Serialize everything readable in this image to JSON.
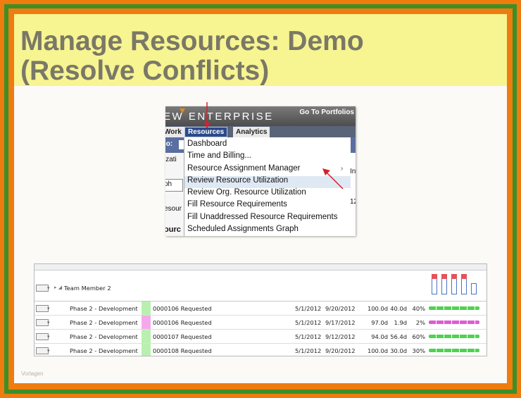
{
  "slide": {
    "title_line1": "Manage Resources: Demo",
    "title_line2": "(Resolve Conflicts)",
    "footer_note": "Vorlagen"
  },
  "colors": {
    "frame_orange": "#ee7c0e",
    "frame_green": "#3e8e28",
    "title_band": "#f7f492",
    "title_text": "#7a7866",
    "nav_active": "#2c4a8a",
    "menu_highlight": "#dfe9f4",
    "arrow_red": "#d7212a",
    "swatch_green": "#b9f0b0",
    "swatch_pink": "#f6a8ec",
    "bar_green": "#4fd24f",
    "bar_pink": "#e25bd4",
    "conflict_red": "#e2535a"
  },
  "menu_screenshot": {
    "brand": "EW ENTERPRISE",
    "header_link": "Go To Portfolios",
    "tabs": {
      "work": "Work",
      "resources": "Resources",
      "analytics": "Analytics"
    },
    "left_panel": {
      "label": "io:",
      "text_1": "izati",
      "text_2": "ph",
      "text_3": "esour",
      "text_4": "ourc"
    },
    "right_panel": {
      "text_1": "In",
      "text_2": "12"
    },
    "dropdown_items": [
      {
        "label": "Dashboard"
      },
      {
        "label": "Time and Billing..."
      },
      {
        "label": "Resource Assignment Manager"
      },
      {
        "label": "Review Resource Utilization"
      },
      {
        "label": "Review Org. Resource Utilization"
      },
      {
        "label": "Fill Resource Requirements"
      },
      {
        "label": "Fill Unaddressed Resource Requirements"
      },
      {
        "label": "Scheduled Assignments Graph"
      }
    ],
    "submenu_arrow": "›"
  },
  "grid_screenshot": {
    "team_label": "Team Member 2",
    "rows": [
      {
        "phase": "Phase 2 - Development",
        "swatch": "green",
        "id": "0000106",
        "status": "Requested",
        "start": "5/1/2012",
        "end": "9/20/2012",
        "total": "100.0d",
        "assigned": "40.0d",
        "percent": "40%",
        "bar": "green"
      },
      {
        "phase": "Phase 2 - Development",
        "swatch": "pink",
        "id": "0000106",
        "status": "Requested",
        "start": "5/1/2012",
        "end": "9/17/2012",
        "total": "97.0d",
        "assigned": "1.9d",
        "percent": "2%",
        "bar": "pink"
      },
      {
        "phase": "Phase 2 - Development",
        "swatch": "green",
        "id": "0000107",
        "status": "Requested",
        "start": "5/1/2012",
        "end": "9/12/2012",
        "total": "94.0d",
        "assigned": "56.4d",
        "percent": "60%",
        "bar": "green"
      },
      {
        "phase": "Phase 2 - Development",
        "swatch": "green",
        "id": "0000108",
        "status": "Requested",
        "start": "5/1/2012",
        "end": "9/20/2012",
        "total": "100.0d",
        "assigned": "30.0d",
        "percent": "30%",
        "bar": "green"
      }
    ],
    "mini_chart_levels": [
      0.9,
      0.9,
      0.9,
      0.9,
      0.45
    ],
    "mini_chart_overbooked": [
      true,
      true,
      true,
      true,
      false
    ]
  }
}
